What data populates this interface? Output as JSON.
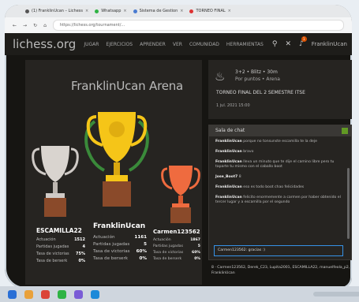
{
  "browser": {
    "tabs": [
      {
        "label": "(1) FranklinUcan – Lichess"
      },
      {
        "label": "Whatsapp"
      },
      {
        "label": "Sistema de Gestion"
      },
      {
        "label": "TORNEO FINAL"
      }
    ],
    "url": "https://lichess.org/tournament/..."
  },
  "nav": {
    "logo": "lichess.org",
    "items": [
      "JUGAR",
      "EJERCICIOS",
      "APRENDER",
      "VER",
      "COMUNIDAD",
      "HERRAMIENTAS"
    ],
    "username": "FranklinUcan",
    "notification_count": "1"
  },
  "arena": {
    "title": "FranklinUcan Arena",
    "stat_labels": {
      "games": "Partidas jugadas",
      "win": "Tasa de victorias",
      "berserk": "Tasa de berserk"
    },
    "first": {
      "name": "FranklinUcan",
      "rating_label": "Actuación",
      "rating": "1161",
      "games": "5",
      "win_rate": "60%",
      "berserk": "0%"
    },
    "second": {
      "name": "ESCAMILLA22",
      "rating_label": "Actuación",
      "rating": "1512",
      "games": "4",
      "win_rate": "75%",
      "berserk": "0%"
    },
    "third": {
      "name": "Carmen123562",
      "rating_label": "Actuación",
      "rating": "1867",
      "games": "5",
      "win_rate": "60%",
      "berserk": "0%"
    }
  },
  "tournament": {
    "line1": "3+2 • Blitz • 30m",
    "line2": "Por puntos • Arena",
    "name": "TORNEO FINAL DEL 2 SEMESTRE ITSE",
    "date": "1 jul. 2021 15:00"
  },
  "chat": {
    "title": "Sala de chat",
    "messages": [
      {
        "user": "FranklinUcan",
        "text": "porque no tonsunste escamilla te la deje"
      },
      {
        "user": "FranklinUcan",
        "text": "bravo"
      },
      {
        "user": "FranklinUcan",
        "text": "lleva un minuto que te dije el camino libre pero tu taparte tu mismo con el caballo boot"
      },
      {
        "user": "Jose_Boot7",
        "text": "8"
      },
      {
        "user": "FranklinUcan",
        "text": "eso es todo boot chao felicidades"
      },
      {
        "user": "FranklinUcan",
        "text": "felicito enormemente a carmen por haber obtenido el tercer lugar y a escamilla por el segundo"
      }
    ],
    "input_value": "Carmen123562: gracias :)"
  },
  "online": "8 · Carmen123562, Derek_C23, Lupita2001, ESCAMILLA22, manuelfeola_p2, FranklinUcan",
  "colors": {
    "gold": "#f5c518",
    "silver": "#cfcac6",
    "bronze": "#ef6b3f"
  }
}
